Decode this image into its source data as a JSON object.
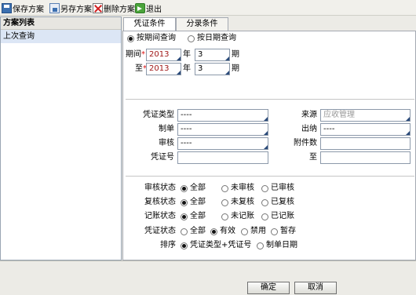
{
  "toolbar": {
    "save": "保存方案",
    "save_as": "另存方案",
    "delete": "删除方案",
    "exit": "退出"
  },
  "left_panel": {
    "header": "方案列表",
    "items": [
      "上次查询"
    ]
  },
  "tabs": [
    {
      "label": "凭证条件",
      "active": true
    },
    {
      "label": "分录条件",
      "active": false
    }
  ],
  "query_mode": {
    "by_period": "按期间查询",
    "by_date": "按日期查询",
    "selected": "by_period"
  },
  "period": {
    "from_label": "期间",
    "to_label": "至",
    "required_mark": "*",
    "year_unit": "年",
    "period_unit": "期",
    "from_year": "2013",
    "from_period": "3",
    "to_year": "2013",
    "to_period": "3"
  },
  "filters": {
    "voucher_type_label": "凭证类型",
    "voucher_type_value": "----",
    "maker_label": "制单",
    "maker_value": "----",
    "auditor_label": "审核",
    "auditor_value": "----",
    "voucher_no_label": "凭证号",
    "voucher_no_value": "",
    "source_label": "来源",
    "source_value": "应收管理",
    "cashier_label": "出纳",
    "cashier_value": "----",
    "attachments_label": "附件数",
    "attachments_value": "",
    "to_label": "至",
    "to_value": ""
  },
  "status": {
    "audit": {
      "label": "审核状态",
      "options": [
        "全部",
        "未审核",
        "已审核"
      ],
      "selected": 0
    },
    "review": {
      "label": "复核状态",
      "options": [
        "全部",
        "未复核",
        "已复核"
      ],
      "selected": 0
    },
    "posting": {
      "label": "记账状态",
      "options": [
        "全部",
        "未记账",
        "已记账"
      ],
      "selected": 0
    },
    "voucher": {
      "label": "凭证状态",
      "options": [
        "全部",
        "有效",
        "禁用",
        "暂存"
      ],
      "selected": 1
    },
    "sort": {
      "label": "排序",
      "options": [
        "凭证类型+凭证号",
        "制单日期"
      ],
      "selected": 0
    }
  },
  "buttons": {
    "ok": "确定",
    "cancel": "取消"
  }
}
